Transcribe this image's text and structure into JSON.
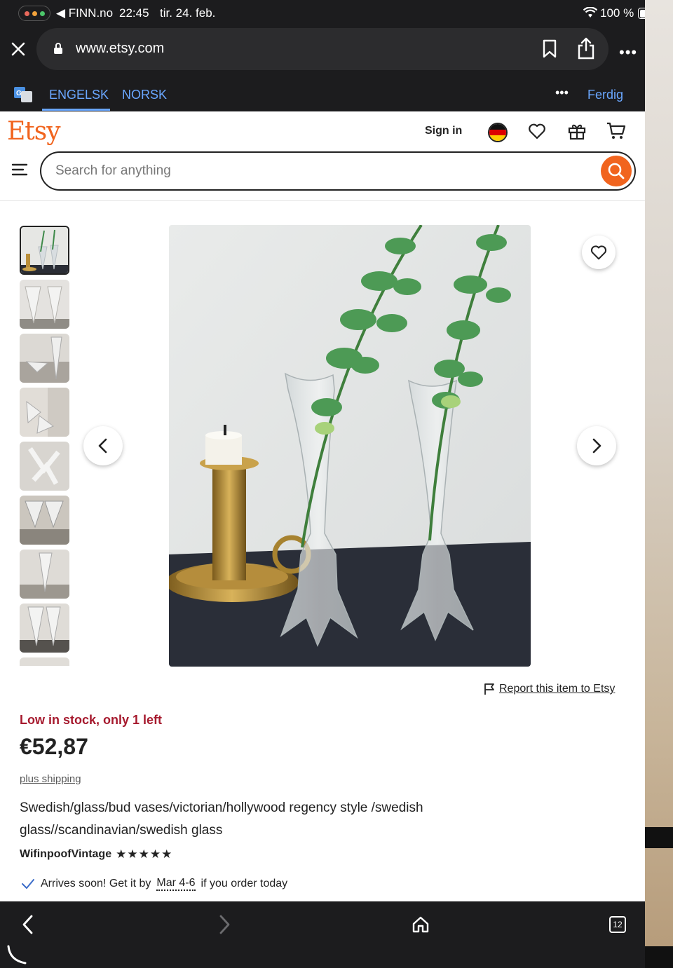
{
  "status_bar": {
    "back_app": "◀ FINN.no",
    "time": "22:45",
    "date": "tir. 24. feb.",
    "battery": "100 %"
  },
  "browser": {
    "url": "www.etsy.com"
  },
  "translate": {
    "languages": [
      "ENGELSK",
      "NORSK"
    ],
    "more": "•••",
    "done": "Ferdig"
  },
  "header": {
    "logo": "Etsy",
    "sign_in": "Sign in",
    "search_placeholder": "Search for anything"
  },
  "listing": {
    "report_link": "Report this item to Etsy",
    "stock_notice": "Low in stock, only 1 left",
    "price": "€52,87",
    "shipping": "plus shipping",
    "title": "Swedish/glass/bud vases/victorian/hollywood regency style /swedish glass//scandinavian/swedish glass",
    "shop_name": "WifinpoofVintage",
    "rating": 5,
    "stars": "★★★★★",
    "arrives_pre": "Arrives soon! Get it by",
    "arrives_date": "Mar 4-6",
    "arrives_post": "if you order today",
    "thumbnail_count": 9
  },
  "toolbar": {
    "tab_count": "12"
  },
  "colors": {
    "brand": "#f1641e",
    "stock_red": "#a61a2e",
    "translate_blue": "#6aa7ff"
  }
}
